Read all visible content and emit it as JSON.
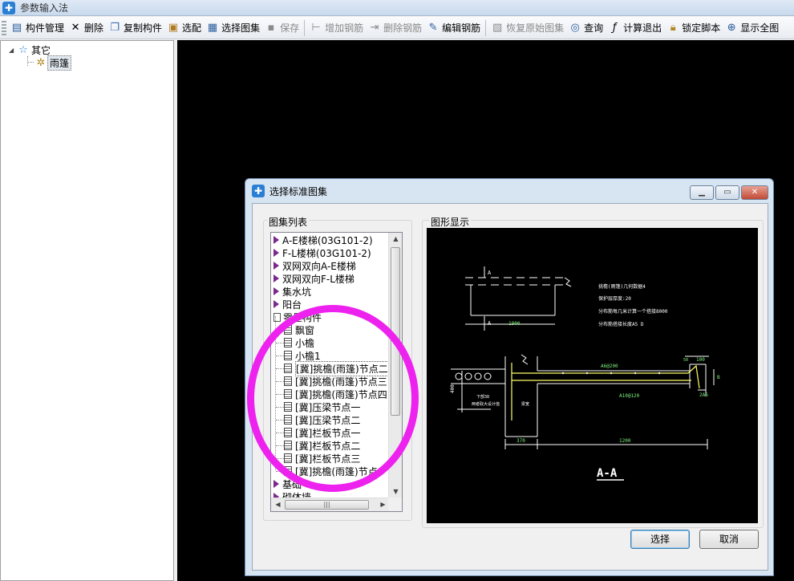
{
  "window": {
    "title": "参数输入法",
    "icon": "app-cross-icon"
  },
  "toolbar": {
    "items": [
      {
        "label": "构件管理",
        "icon": "component-manage-icon",
        "enabled": true
      },
      {
        "label": "删除",
        "icon": "delete-x-icon",
        "enabled": true
      },
      {
        "label": "复制构件",
        "icon": "copy-icon",
        "enabled": true
      },
      {
        "label": "选配",
        "icon": "select-config-icon",
        "enabled": true
      },
      {
        "label": "选择图集",
        "icon": "atlas-icon",
        "enabled": true
      },
      {
        "label": "保存",
        "icon": "save-icon",
        "enabled": false
      },
      {
        "label": "增加钢筋",
        "icon": "add-rebar-icon",
        "enabled": false
      },
      {
        "label": "删除钢筋",
        "icon": "remove-rebar-icon",
        "enabled": false
      },
      {
        "label": "编辑钢筋",
        "icon": "edit-rebar-icon",
        "enabled": true
      },
      {
        "label": "恢复原始图集",
        "icon": "restore-icon",
        "enabled": false
      },
      {
        "label": "查询",
        "icon": "binoculars-icon",
        "enabled": true
      },
      {
        "label": "计算退出",
        "icon": "calc-exit-icon",
        "enabled": true
      },
      {
        "label": "锁定脚本",
        "icon": "lock-icon",
        "enabled": true
      },
      {
        "label": "显示全图",
        "icon": "zoom-all-icon",
        "enabled": true
      }
    ]
  },
  "tree": {
    "root": "其它",
    "child": "雨篷"
  },
  "dialog": {
    "title": "选择标准图集",
    "list_group_label": "图集列表",
    "preview_group_label": "图形显示",
    "list_items": [
      {
        "label": "A-E楼梯(03G101-2)",
        "kind": "folder"
      },
      {
        "label": "F-L楼梯(03G101-2)",
        "kind": "folder"
      },
      {
        "label": "双网双向A-E楼梯",
        "kind": "folder"
      },
      {
        "label": "双网双向F-L楼梯",
        "kind": "folder"
      },
      {
        "label": "集水坑",
        "kind": "folder"
      },
      {
        "label": "阳台",
        "kind": "folder"
      },
      {
        "label": "零星构件",
        "kind": "open"
      },
      {
        "label": "飘窗",
        "kind": "doc"
      },
      {
        "label": "小檐",
        "kind": "doc"
      },
      {
        "label": "小檐1",
        "kind": "doc"
      },
      {
        "label": "[冀]挑檐(雨篷)节点二",
        "kind": "doc",
        "selected": true
      },
      {
        "label": "[冀]挑檐(雨篷)节点三",
        "kind": "doc"
      },
      {
        "label": "[冀]挑檐(雨篷)节点四",
        "kind": "doc"
      },
      {
        "label": "[冀]压梁节点一",
        "kind": "doc"
      },
      {
        "label": "[冀]压梁节点二",
        "kind": "doc"
      },
      {
        "label": "[冀]栏板节点一",
        "kind": "doc"
      },
      {
        "label": "[冀]栏板节点二",
        "kind": "doc"
      },
      {
        "label": "[冀]栏板节点三",
        "kind": "doc"
      },
      {
        "label": "[冀]挑檐(雨篷)节点",
        "kind": "doc"
      },
      {
        "label": "基础",
        "kind": "folder"
      },
      {
        "label": "砌体墙",
        "kind": "folder"
      }
    ],
    "drawing": {
      "labels": {
        "section_mark": "A",
        "plan_dim": "1900",
        "note1": "挑檐(雨篷)几何数据4",
        "note2": "保护层厚度:20",
        "note3": "分布筋每几米计算一个搭接8000",
        "note4": "分布筋搭接长度A5  D",
        "rebar_top": "A6@200",
        "rebar_main": "A10@120",
        "depth": "400",
        "dim_right_top": "100",
        "dim_right_small": "50",
        "base_left": "370",
        "base_right": "1200",
        "tag_2a6": "2A6",
        "tag_b": "B",
        "note_low1": "下部38",
        "note_low2": "两者取大设计值",
        "note_low3": "梁宽",
        "section_title": "A-A"
      }
    },
    "buttons": {
      "select": "选择",
      "cancel": "取消"
    }
  },
  "colors": {
    "annotation_ring": "#ee22ee",
    "accent": "#2a7fd4"
  }
}
